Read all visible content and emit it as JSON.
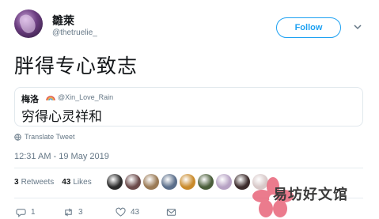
{
  "author": {
    "display_name": "雛萊",
    "handle": "@thetruelie_"
  },
  "follow_label": "Follow",
  "tweet_text": "胖得专心致志",
  "quote": {
    "name": "梅洛",
    "handle": "@Xin_Love_Rain",
    "text": "穷得心灵祥和"
  },
  "translate_label": "Translate Tweet",
  "timestamp": "12:31 AM - 19 May 2019",
  "stats": {
    "retweets_count": "3",
    "retweets_label": "Retweets",
    "likes_count": "43",
    "likes_label": "Likes"
  },
  "liker_avatar_colors": [
    "#2b2b2b",
    "#6b4a4a",
    "#9a7a55",
    "#5a6e8a",
    "#c98a2a",
    "#4a5e3a",
    "#b7a2c4",
    "#3b2a2a",
    "#d8c8c8"
  ],
  "actions": {
    "reply_count": "1",
    "retweet_count": "3",
    "like_count": "43"
  },
  "watermark": {
    "text": "易坊好文馆",
    "color": "#e8647a"
  },
  "colors": {
    "accent": "#1da1f2",
    "secondary_text": "#657786"
  }
}
